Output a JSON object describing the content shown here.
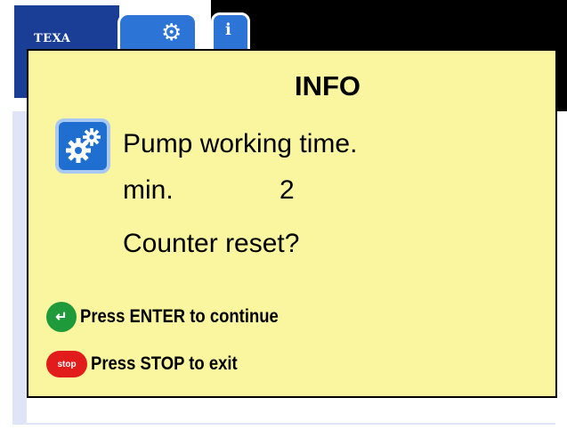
{
  "background": {
    "logo_text": "TEXA"
  },
  "dialog": {
    "title": "INFO",
    "icon": "gears-icon",
    "lines": {
      "message": "Pump working time.",
      "unit": "min.",
      "value": "2",
      "question": "Counter reset?"
    },
    "keys": {
      "enter_badge": "↵",
      "enter_label": "Press ENTER to continue",
      "stop_badge": "stop",
      "stop_label": "Press STOP to exit"
    }
  },
  "colors": {
    "dialog_bg": "#faf59f",
    "accent_blue": "#1f6fd0",
    "enter_green": "#1f9a3a",
    "stop_red": "#e21b1b"
  }
}
